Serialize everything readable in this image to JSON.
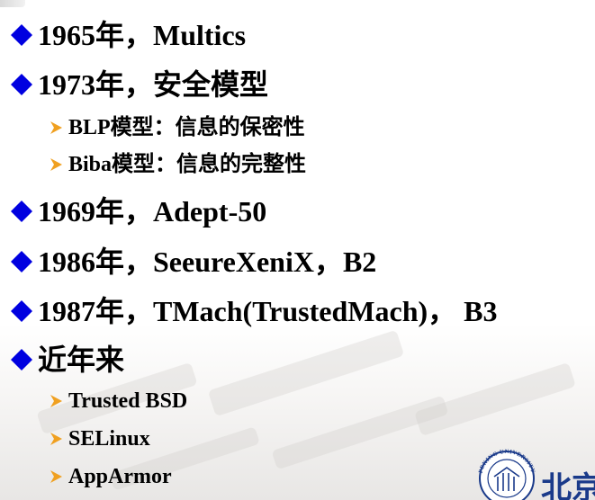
{
  "colors": {
    "diamond_bullet": "#0000e0",
    "arrow_bullet": "#f0a020"
  },
  "icons": {
    "level1": "diamond-bullet-icon",
    "level2": "arrow-bullet-icon",
    "logo": "university-seal-icon"
  },
  "items": [
    {
      "level": 1,
      "text": "1965年，Multics"
    },
    {
      "level": 1,
      "text": "1973年，安全模型"
    },
    {
      "level": 2,
      "text": "BLP模型：信息的保密性"
    },
    {
      "level": 2,
      "text": "Biba模型：信息的完整性"
    },
    {
      "level": 1,
      "text": "1969年，Adept-50"
    },
    {
      "level": 1,
      "text": "1986年，SeeureXeniX，B2"
    },
    {
      "level": 1,
      "text": "1987年，TMach(TrustedMach)， B3"
    },
    {
      "level": 1,
      "text": "近年来"
    },
    {
      "level": 2,
      "text": "Trusted BSD"
    },
    {
      "level": 2,
      "text": "SELinux"
    },
    {
      "level": 2,
      "text": "AppArmor"
    }
  ],
  "logo": {
    "seal_text": "PEKING UNIVERSITY",
    "name_partial": "北京"
  }
}
